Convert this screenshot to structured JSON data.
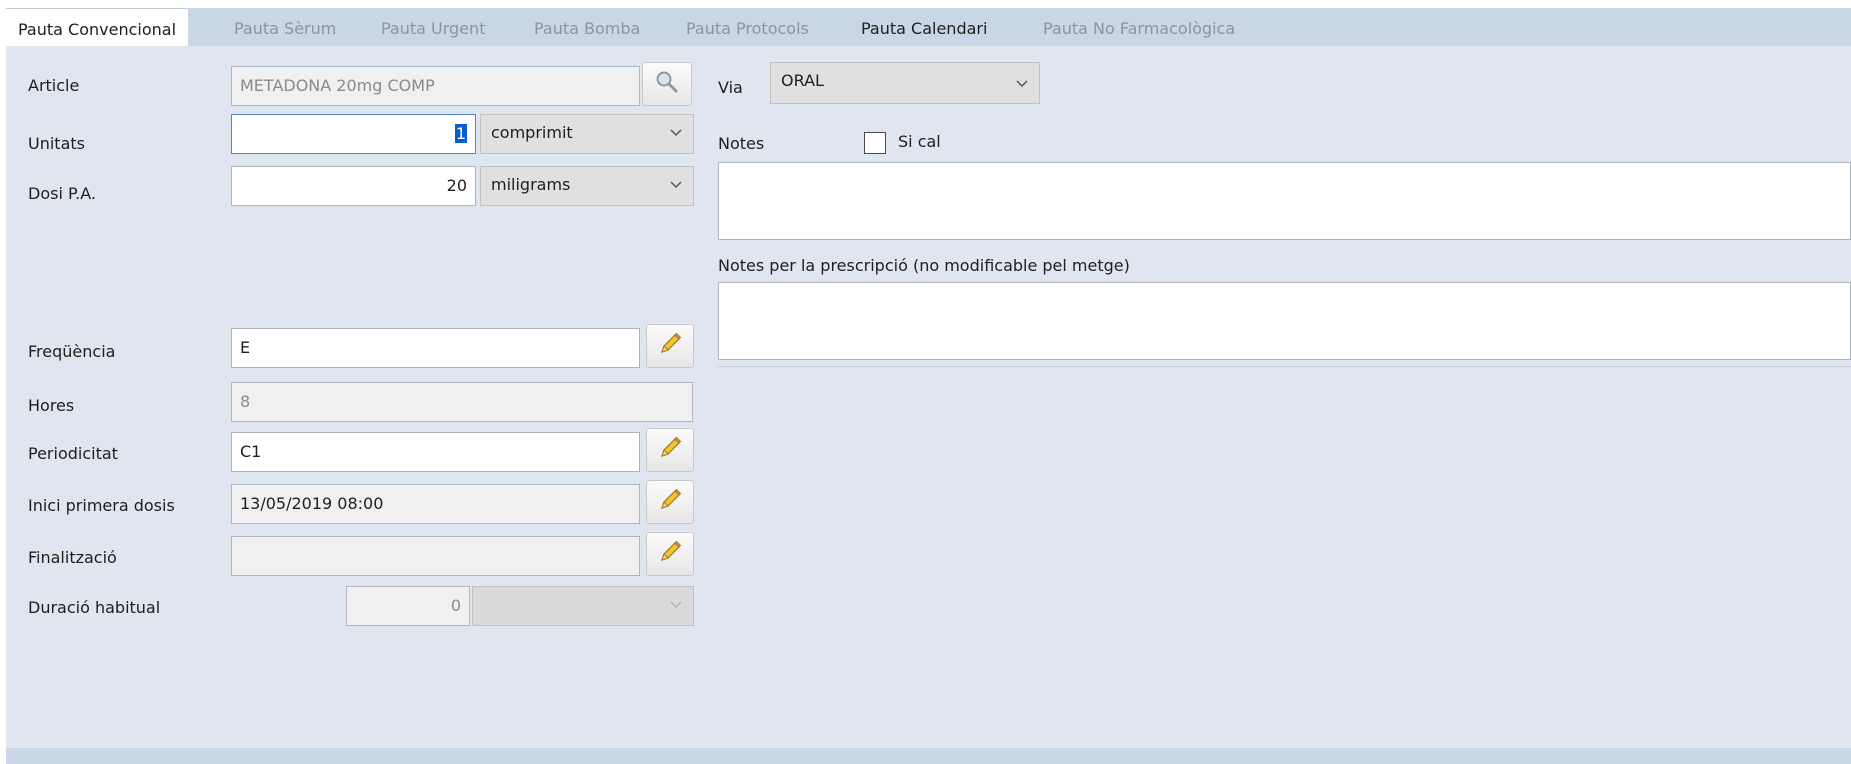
{
  "tabs": [
    {
      "label": "Pauta Convencional"
    },
    {
      "label": "Pauta Sèrum"
    },
    {
      "label": "Pauta Urgent"
    },
    {
      "label": "Pauta Bomba"
    },
    {
      "label": "Pauta Protocols"
    },
    {
      "label": "Pauta Calendari"
    },
    {
      "label": "Pauta No Farmacològica"
    }
  ],
  "form": {
    "article_label": "Article",
    "article_value": "METADONA 20mg COMP",
    "unitats_label": "Unitats",
    "unitats_value": "1",
    "unitats_unit": "comprimit",
    "dosi_label": "Dosi P.A.",
    "dosi_value": "20",
    "dosi_unit": "miligrams",
    "frequencia_label": "Freqüència",
    "frequencia_value": "E",
    "hores_label": "Hores",
    "hores_value": "8",
    "periodicitat_label": "Periodicitat",
    "periodicitat_value": "C1",
    "inici_label": "Inici primera dosis",
    "inici_value": "13/05/2019 08:00",
    "finalitzacio_label": "Finalització",
    "finalitzacio_value": "",
    "duracio_label": "Duració habitual",
    "duracio_value": "0",
    "duracio_unit": ""
  },
  "right": {
    "via_label": "Via",
    "via_value": "ORAL",
    "notes_label": "Notes",
    "sical_label": "Si cal",
    "sical_checked": false,
    "notes_prescripcio_label": "Notes per la prescripció (no modificable pel metge)"
  },
  "icons": {
    "search": "search-icon",
    "edit": "pencil-icon",
    "dropdown": "chevron-down-icon"
  }
}
